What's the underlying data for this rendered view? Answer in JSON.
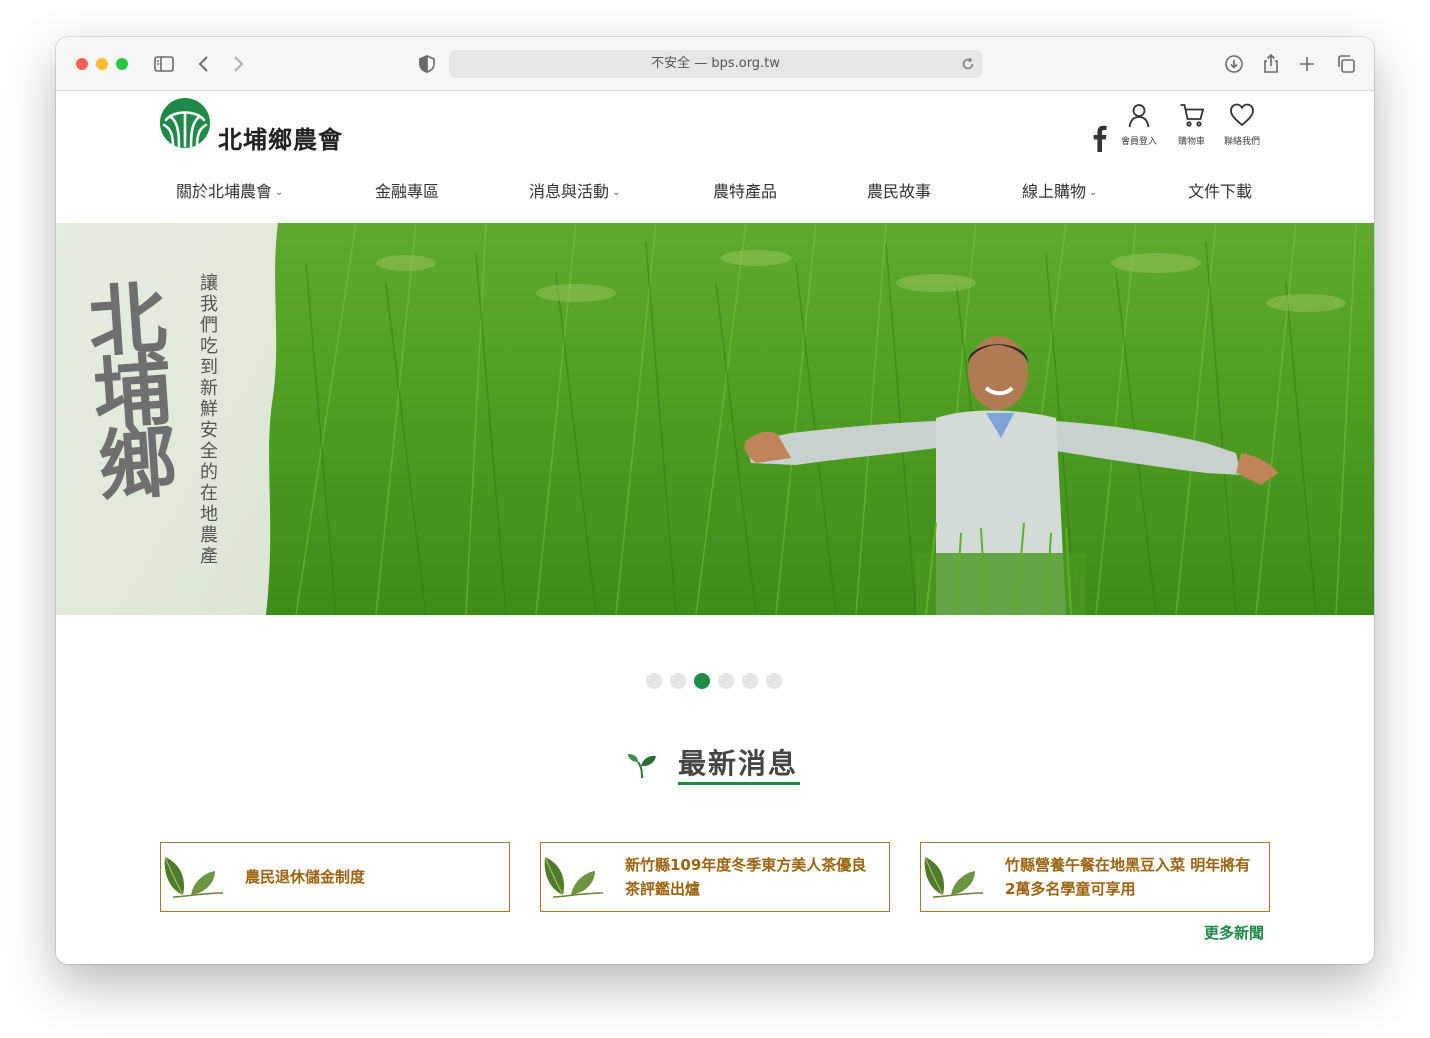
{
  "browser": {
    "url_text": "不安全 — bps.org.tw"
  },
  "site": {
    "logo_text": "北埔鄉農會",
    "utility": [
      {
        "label": "會員登入",
        "icon": "user-icon"
      },
      {
        "label": "購物車",
        "icon": "cart-icon"
      },
      {
        "label": "聯絡我們",
        "icon": "heart-icon"
      }
    ],
    "nav": [
      {
        "label": "關於北埔農會",
        "dropdown": true
      },
      {
        "label": "金融專區",
        "dropdown": false
      },
      {
        "label": "消息與活動",
        "dropdown": true
      },
      {
        "label": "農特產品",
        "dropdown": false
      },
      {
        "label": "農民故事",
        "dropdown": false
      },
      {
        "label": "線上購物",
        "dropdown": true
      },
      {
        "label": "文件下載",
        "dropdown": false
      }
    ],
    "chevron": "⌄"
  },
  "hero": {
    "calligraphy": "北埔鄉",
    "tagline": "讓我們吃到新鮮安全的在地農產",
    "slide_count": 6,
    "active_slide": 3
  },
  "news": {
    "title": "最新消息",
    "items": [
      "農民退休儲金制度",
      "新竹縣109年度冬季東方美人茶優良茶評鑑出爐",
      "竹縣營養午餐在地黑豆入菜 明年將有2萬多名學童可享用"
    ],
    "more": "更多新聞"
  },
  "colors": {
    "brand_green": "#1f8a48",
    "card_border": "#9c7a2e",
    "card_text": "#9c6412"
  }
}
